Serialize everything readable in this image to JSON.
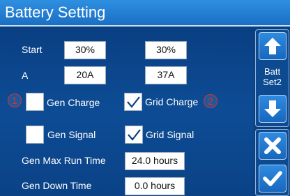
{
  "title": "Battery Setting",
  "rows": {
    "start_label": "Start",
    "start_val1": "30%",
    "start_val2": "30%",
    "a_label": "A",
    "a_val1": "20A",
    "a_val2": "37A"
  },
  "markers": {
    "m1": "1",
    "m2": "2"
  },
  "options": {
    "gen_charge": {
      "label": "Gen Charge",
      "checked": false
    },
    "grid_charge": {
      "label": "Grid Charge",
      "checked": true
    },
    "gen_signal": {
      "label": "Gen Signal",
      "checked": false
    },
    "grid_signal": {
      "label": "Grid Signal",
      "checked": true
    }
  },
  "gen_max_run_time": {
    "label": "Gen Max Run Time",
    "value": "24.0 hours"
  },
  "gen_down_time": {
    "label": "Gen Down Time",
    "value": "0.0 hours"
  },
  "side": {
    "batt_label_line1": "Batt",
    "batt_label_line2": "Set2",
    "icons": [
      "arrow-up-icon",
      "arrow-down-icon",
      "close-icon",
      "checkmark-icon"
    ]
  },
  "colors": {
    "header": "#1a6fc4",
    "background": "#0d4a8f",
    "marker": "#e03030"
  }
}
